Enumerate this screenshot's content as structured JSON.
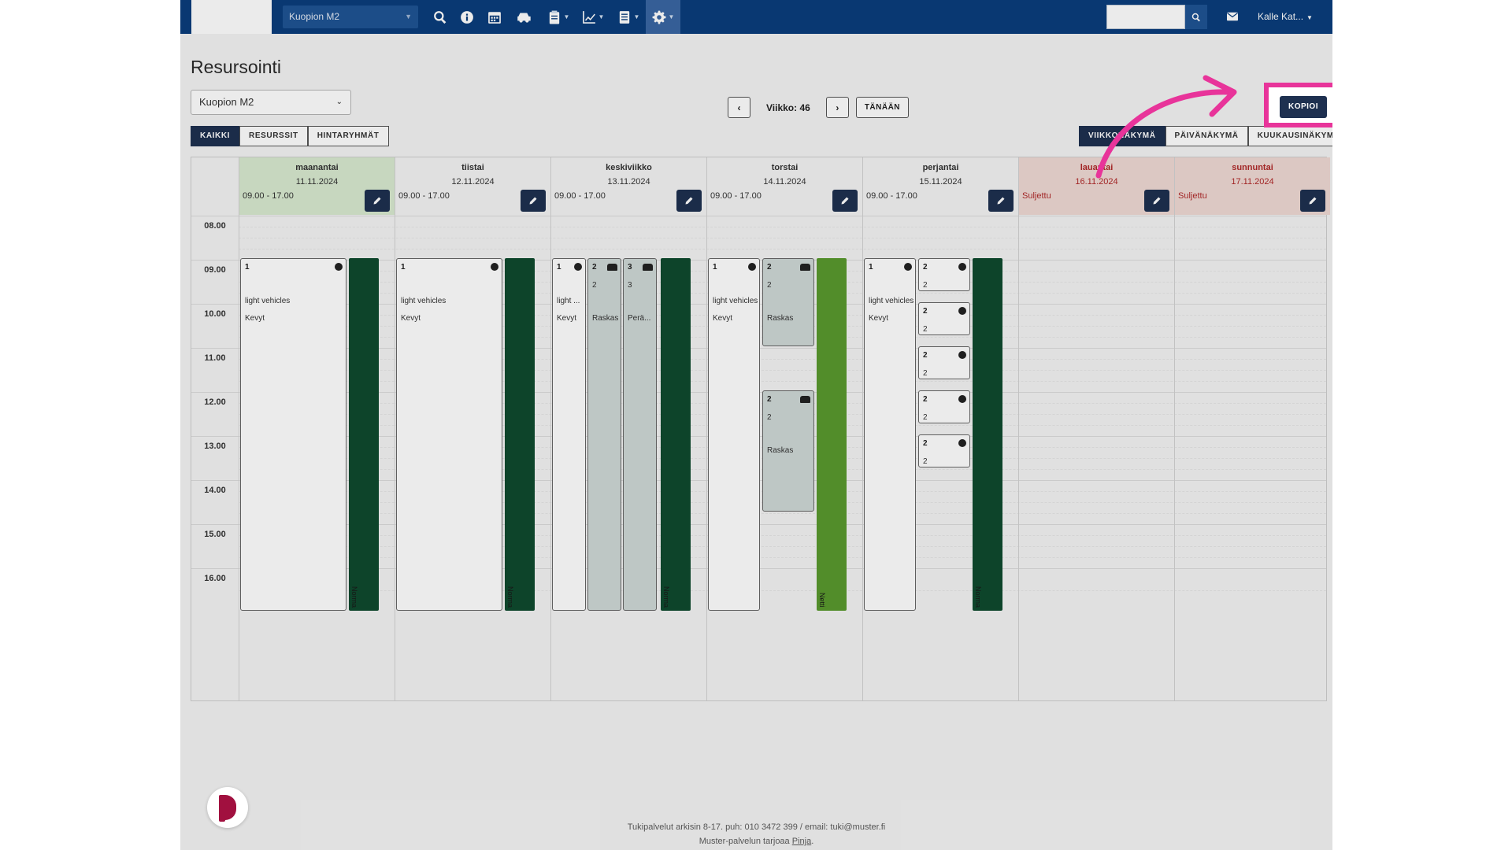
{
  "topbar": {
    "location": "Kuopion M2",
    "user": "Kalle Kat..."
  },
  "page": {
    "title": "Resursointi",
    "resource_select": "Kuopion M2",
    "filters": [
      "KAIKKI",
      "RESURSSIT",
      "HINTARYHMÄT"
    ],
    "active_filter": "KAIKKI",
    "week_label": "Viikko: 46",
    "today": "TÄNÄÄN",
    "copy": "KOPIOI",
    "views": [
      "VIIKKONÄKYMÄ",
      "PÄIVÄNÄKYMÄ",
      "KUUKAUSINÄKYMÄ"
    ],
    "active_view": "VIIKKONÄKYMÄ"
  },
  "hours": [
    "08.00",
    "09.00",
    "10.00",
    "11.00",
    "12.00",
    "13.00",
    "14.00",
    "15.00",
    "16.00"
  ],
  "days": [
    {
      "name": "maanantai",
      "date": "11.11.2024",
      "hours": "09.00 - 17.00",
      "closed": false
    },
    {
      "name": "tiistai",
      "date": "12.11.2024",
      "hours": "09.00 - 17.00",
      "closed": false
    },
    {
      "name": "keskiviikko",
      "date": "13.11.2024",
      "hours": "09.00 - 17.00",
      "closed": false
    },
    {
      "name": "torstai",
      "date": "14.11.2024",
      "hours": "09.00 - 17.00",
      "closed": false
    },
    {
      "name": "perjantai",
      "date": "15.11.2024",
      "hours": "09.00 - 17.00",
      "closed": false
    },
    {
      "name": "lauantai",
      "date": "16.11.2024",
      "hours": "Suljettu",
      "closed": true
    },
    {
      "name": "sunnuntai",
      "date": "17.11.2024",
      "hours": "Suljettu",
      "closed": true
    }
  ],
  "slot_text": {
    "n1": "1",
    "n2": "2",
    "n3": "3",
    "light": "light vehicles",
    "light_short": "light ...",
    "kevyt": "Kevyt",
    "raskas": "Raskas",
    "peravaunu": "Perä...",
    "normal_bar": "Norma",
    "netti_bar": "Netti"
  },
  "colors": {
    "nav": "#0a3d7c",
    "dark_button": "#1e3050",
    "highlight": "#e8349a",
    "bar_dark_green": "#0f4a2e",
    "bar_light_green": "#5a9a2e",
    "today_header": "#d8ead0",
    "closed_header": "#efd9d4",
    "closed_text": "#b02a2a"
  },
  "icons": [
    "search-icon",
    "info-icon",
    "calendar-icon",
    "car-icon",
    "clipboard-icon",
    "chart-icon",
    "document-icon",
    "gear-icon",
    "mail-icon",
    "pencil-icon",
    "globe-icon"
  ],
  "footer": {
    "support": "Tukipalvelut arkisin 8-17. puh: 010 3472 399 / email: tuki@muster.fi",
    "provider_prefix": "Muster-palvelun tarjoaa",
    "provider_link": "Pinja",
    "provider_suffix": "."
  }
}
